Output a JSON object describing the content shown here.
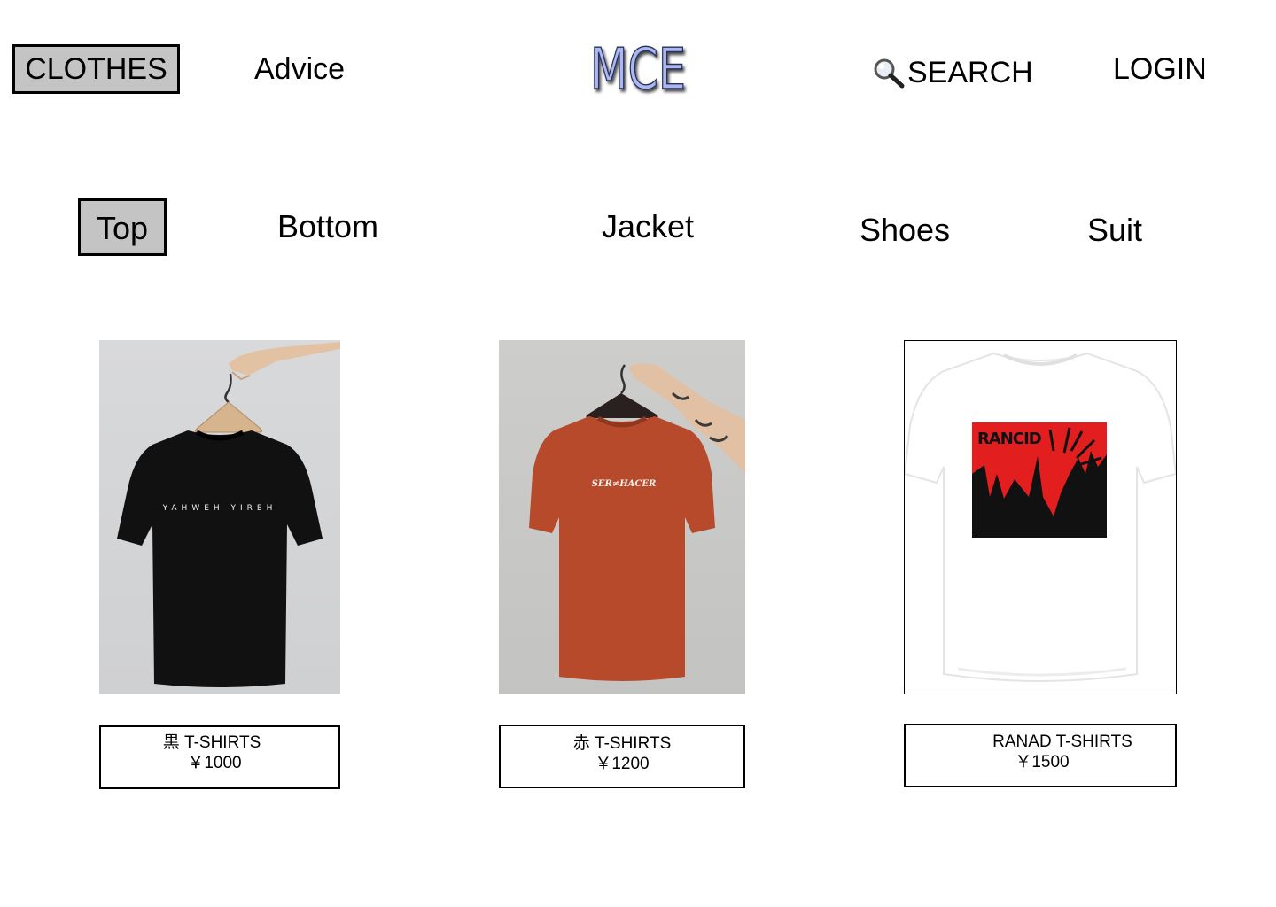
{
  "header": {
    "nav_clothes": "CLOTHES",
    "nav_advice": "Advice",
    "logo_text": "MCE",
    "search_label": "SEARCH",
    "search_icon": "magnifying-glass-icon",
    "login_label": "LOGIN"
  },
  "categories": {
    "top": "Top",
    "bottom": "Bottom",
    "jacket": "Jacket",
    "shoes": "Shoes",
    "suit": "Suit"
  },
  "products": [
    {
      "name": "黒 T-SHIRTS",
      "price": "￥1000",
      "shirt_color": "#111111",
      "print_text": "YAHWEH YIREH"
    },
    {
      "name": "赤 T-SHIRTS",
      "price": "￥1200",
      "shirt_color": "#b84a2c",
      "print_text": "SER≠HACER"
    },
    {
      "name": "RANAD T-SHIRTS",
      "price": "￥1500",
      "shirt_color": "#ffffff",
      "print_text": "RANCID"
    }
  ],
  "colors": {
    "active_bg": "#c4c4c4",
    "logo_fill": "#a9b8f2",
    "print_red": "#e31e1e"
  }
}
